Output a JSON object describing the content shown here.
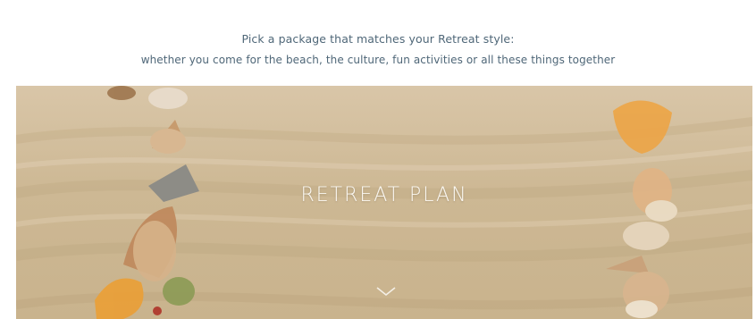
{
  "intro": {
    "line1": "Pick a package that matches your Retreat style:",
    "line2": "whether you come for the beach, the culture, fun activities or all these things together"
  },
  "hero": {
    "title": "RETREAT PLAN",
    "scroll_icon": "chevron-down-icon"
  },
  "colors": {
    "intro_text": "#4f6778",
    "hero_title": "#fbf8f2",
    "sand": "#cdb894",
    "shell_orange": "#e9a03a"
  }
}
